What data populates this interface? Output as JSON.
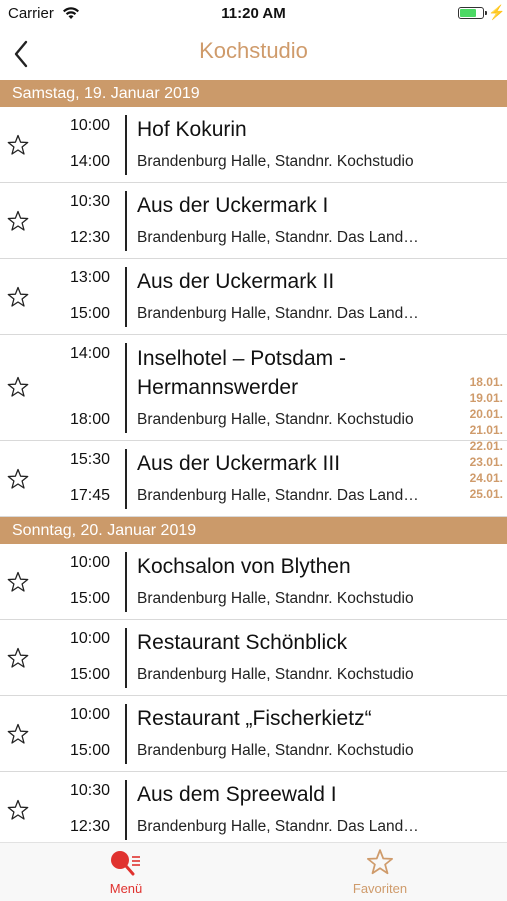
{
  "status_bar": {
    "carrier": "Carrier",
    "time": "11:20 AM"
  },
  "nav": {
    "title": "Kochstudio"
  },
  "colors": {
    "accent": "#cf9b6b",
    "section": "#cb9a6a",
    "active_tab": "#e0322f"
  },
  "sections": [
    {
      "header": "Samstag, 19. Januar 2019",
      "events": [
        {
          "start": "10:00",
          "end": "14:00",
          "title": "Hof Kokurin",
          "location": "Brandenburg Halle, Standnr. Kochstudio"
        },
        {
          "start": "10:30",
          "end": "12:30",
          "title": "Aus der Uckermark I",
          "location": "Brandenburg Halle, Standnr. Das Land…"
        },
        {
          "start": "13:00",
          "end": "15:00",
          "title": "Aus der Uckermark II",
          "location": "Brandenburg Halle, Standnr. Das Land…"
        },
        {
          "start": "14:00",
          "end": "18:00",
          "title": "Inselhotel – Potsdam - Hermannswerder",
          "location": "Brandenburg Halle, Standnr. Kochstudio"
        },
        {
          "start": "15:30",
          "end": "17:45",
          "title": "Aus der Uckermark III",
          "location": "Brandenburg Halle, Standnr. Das Land…"
        }
      ]
    },
    {
      "header": "Sonntag, 20. Januar 2019",
      "events": [
        {
          "start": "10:00",
          "end": "15:00",
          "title": "Kochsalon von Blythen",
          "location": "Brandenburg Halle, Standnr. Kochstudio"
        },
        {
          "start": "10:00",
          "end": "15:00",
          "title": "Restaurant Schönblick",
          "location": "Brandenburg Halle, Standnr. Kochstudio"
        },
        {
          "start": "10:00",
          "end": "15:00",
          "title": "Restaurant „Fischerkietz“",
          "location": "Brandenburg Halle, Standnr. Kochstudio"
        },
        {
          "start": "10:30",
          "end": "12:30",
          "title": "Aus dem Spreewald I",
          "location": "Brandenburg Halle, Standnr. Das Land…"
        }
      ]
    }
  ],
  "date_index": [
    "18.01.",
    "19.01.",
    "20.01.",
    "21.01.",
    "22.01.",
    "23.01.",
    "24.01.",
    "25.01."
  ],
  "tabs": [
    {
      "label": "Menü",
      "icon": "menu-search-icon",
      "active": true
    },
    {
      "label": "Favoriten",
      "icon": "star-icon",
      "active": false
    }
  ]
}
